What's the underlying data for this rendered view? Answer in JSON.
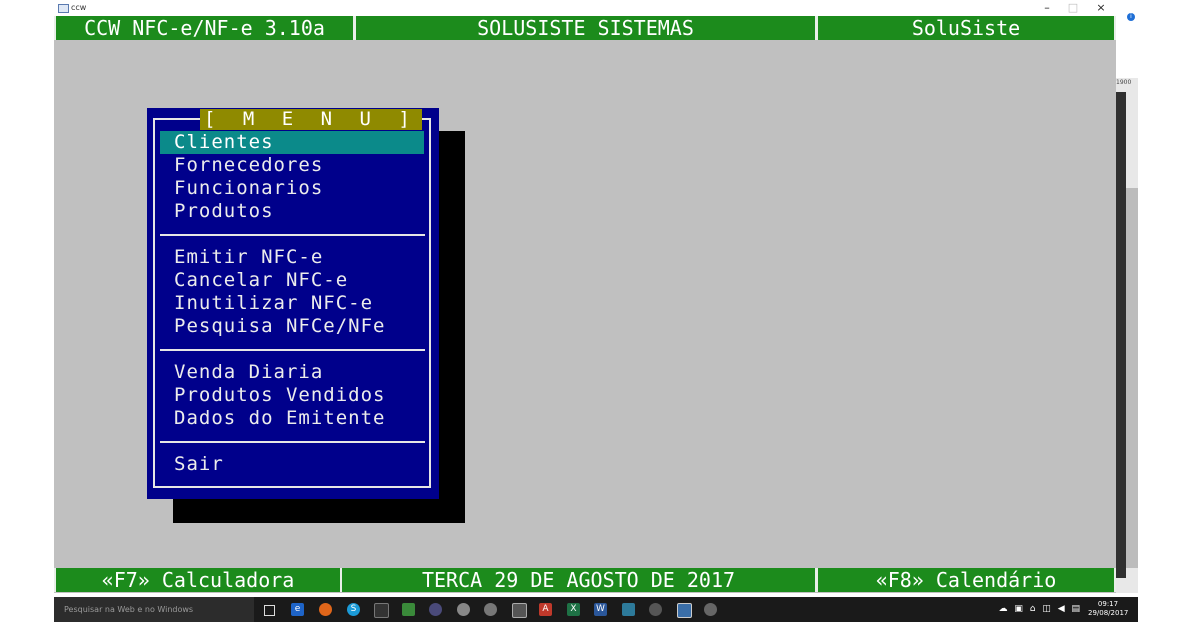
{
  "window": {
    "title": "ccw",
    "minimize": "–",
    "maximize": "□",
    "close": "×"
  },
  "top_bar": {
    "app_version": "CCW NFC-e/NF-e 3.10a",
    "company": "SOLUSISTE SISTEMAS",
    "brand": "SoluSiste"
  },
  "menu": {
    "title": "[ M E N U ]",
    "selected_index": 0,
    "groups": [
      [
        "Clientes",
        "Fornecedores",
        "Funcionarios",
        "Produtos"
      ],
      [
        "Emitir NFC-e",
        "Cancelar NFC-e",
        "Inutilizar NFC-e",
        "Pesquisa NFCe/NFe"
      ],
      [
        "Venda Diaria",
        "Produtos Vendidos",
        "Dados do Emitente"
      ],
      [
        "Sair"
      ]
    ]
  },
  "bottom_bar": {
    "f7": "«F7» Calculadora",
    "date": "TERCA 29 DE AGOSTO DE 2017",
    "f8": "«F8» Calendário"
  },
  "scrollbar": {
    "label": "1900"
  },
  "taskbar": {
    "search_placeholder": "Pesquisar na Web e no Windows",
    "time": "09:17",
    "date": "29/08/2017"
  },
  "colors": {
    "console_bg": "#c0c0c0",
    "bar_green": "#1c8b1c",
    "menu_blue": "#00008b",
    "menu_title_bg": "#8f8a00",
    "selected_bg": "#0b8a8a"
  }
}
